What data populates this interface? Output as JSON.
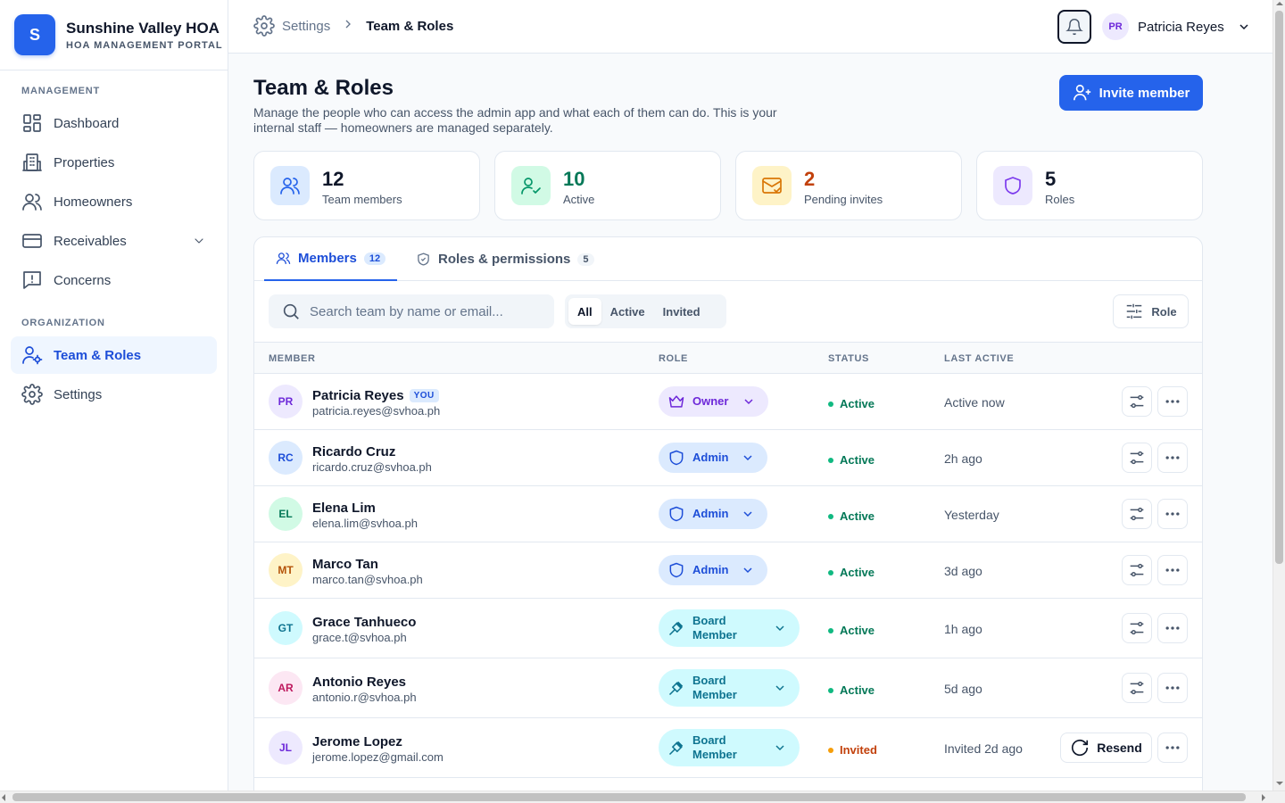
{
  "brand": {
    "logo_letter": "S",
    "name": "Sunshine Valley HOA",
    "subtitle": "HOA MANAGEMENT PORTAL"
  },
  "sidebar": {
    "sections": [
      {
        "title": "MANAGEMENT"
      },
      {
        "title": "ORGANIZATION"
      }
    ],
    "items": [
      {
        "label": "Dashboard",
        "icon": "dashboard-icon"
      },
      {
        "label": "Properties",
        "icon": "building-icon"
      },
      {
        "label": "Homeowners",
        "icon": "users-icon"
      },
      {
        "label": "Receivables",
        "icon": "credit-card-icon"
      },
      {
        "label": "Concerns",
        "icon": "message-alert-icon"
      },
      {
        "label": "Team & Roles",
        "icon": "user-cog-icon",
        "active": true
      },
      {
        "label": "Settings",
        "icon": "gear-icon"
      }
    ]
  },
  "topbar": {
    "breadcrumb": [
      "Settings",
      "Team & Roles"
    ],
    "user": {
      "initials": "PR",
      "name": "Patricia Reyes"
    }
  },
  "page": {
    "title": "Team & Roles",
    "description": "Manage the people who can access the admin app and what each of them can do. This is your internal staff — homeowners are managed separately.",
    "invite_label": "Invite member"
  },
  "stats": [
    {
      "value": "12",
      "label": "Team members",
      "color": "#2563eb"
    },
    {
      "value": "10",
      "label": "Active",
      "color": "#059669"
    },
    {
      "value": "2",
      "label": "Pending invites",
      "color": "#d97706"
    },
    {
      "value": "5",
      "label": "Roles",
      "color": "#7c3aed"
    }
  ],
  "tabs": [
    {
      "label": "Members",
      "count": "12"
    },
    {
      "label": "Roles & permissions",
      "count": "5"
    }
  ],
  "search": {
    "placeholder": "Search team by name or email..."
  },
  "filters": [
    "All",
    "Active",
    "Invited"
  ],
  "role_filter_label": "Role",
  "columns": [
    "MEMBER",
    "ROLE",
    "STATUS",
    "LAST ACTIVE"
  ],
  "you_badge": "YOU",
  "members": [
    {
      "initials": "PR",
      "name": "Patricia Reyes",
      "email": "patricia.reyes@svhoa.ph",
      "role": "Owner",
      "status": "Active",
      "last_active": "Active now"
    },
    {
      "initials": "RC",
      "name": "Ricardo Cruz",
      "email": "ricardo.cruz@svhoa.ph",
      "role": "Admin",
      "status": "Active",
      "last_active": "2h ago"
    },
    {
      "initials": "EL",
      "name": "Elena Lim",
      "email": "elena.lim@svhoa.ph",
      "role": "Admin",
      "status": "Active",
      "last_active": "Yesterday"
    },
    {
      "initials": "MT",
      "name": "Marco Tan",
      "email": "marco.tan@svhoa.ph",
      "role": "Admin",
      "status": "Active",
      "last_active": "3d ago"
    },
    {
      "initials": "GT",
      "name": "Grace Tanhueco",
      "email": "grace.t@svhoa.ph",
      "role": "Board Member",
      "status": "Active",
      "last_active": "1h ago"
    },
    {
      "initials": "AR",
      "name": "Antonio Reyes",
      "email": "antonio.r@svhoa.ph",
      "role": "Board Member",
      "status": "Active",
      "last_active": "5d ago"
    },
    {
      "initials": "JL",
      "name": "Jerome Lopez",
      "email": "jerome.lopez@gmail.com",
      "role": "Board Member",
      "status": "Invited",
      "last_active": "Invited 2d ago",
      "action": "Resend"
    }
  ]
}
